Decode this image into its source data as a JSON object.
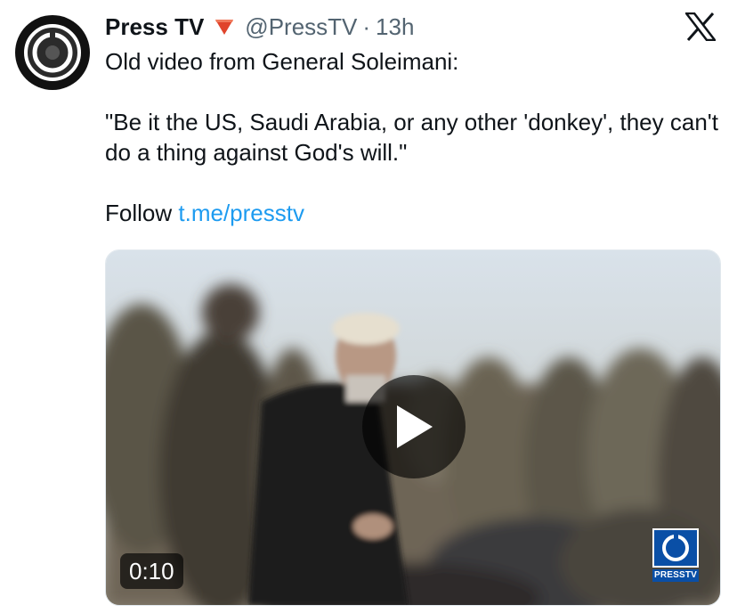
{
  "tweet": {
    "display_name": "Press TV",
    "handle": "@PressTV",
    "separator": "·",
    "time": "13h",
    "text_line1": "Old video from General Soleimani:",
    "quote": "\"Be it the US, Saudi Arabia, or any other 'donkey', they can't do a thing against God's will.\"",
    "follow_label": "Follow",
    "link_text": "t.me/presstv"
  },
  "media": {
    "duration": "0:10",
    "watermark_text": "PRESSTV"
  },
  "icons": {
    "badge": "red-triangle-down-icon",
    "platform_logo": "x-logo-icon",
    "play": "play-icon"
  },
  "colors": {
    "link": "#1d9bf0",
    "muted_text": "#536471",
    "badge": "#e0442b",
    "watermark": "#0a4fa6"
  }
}
